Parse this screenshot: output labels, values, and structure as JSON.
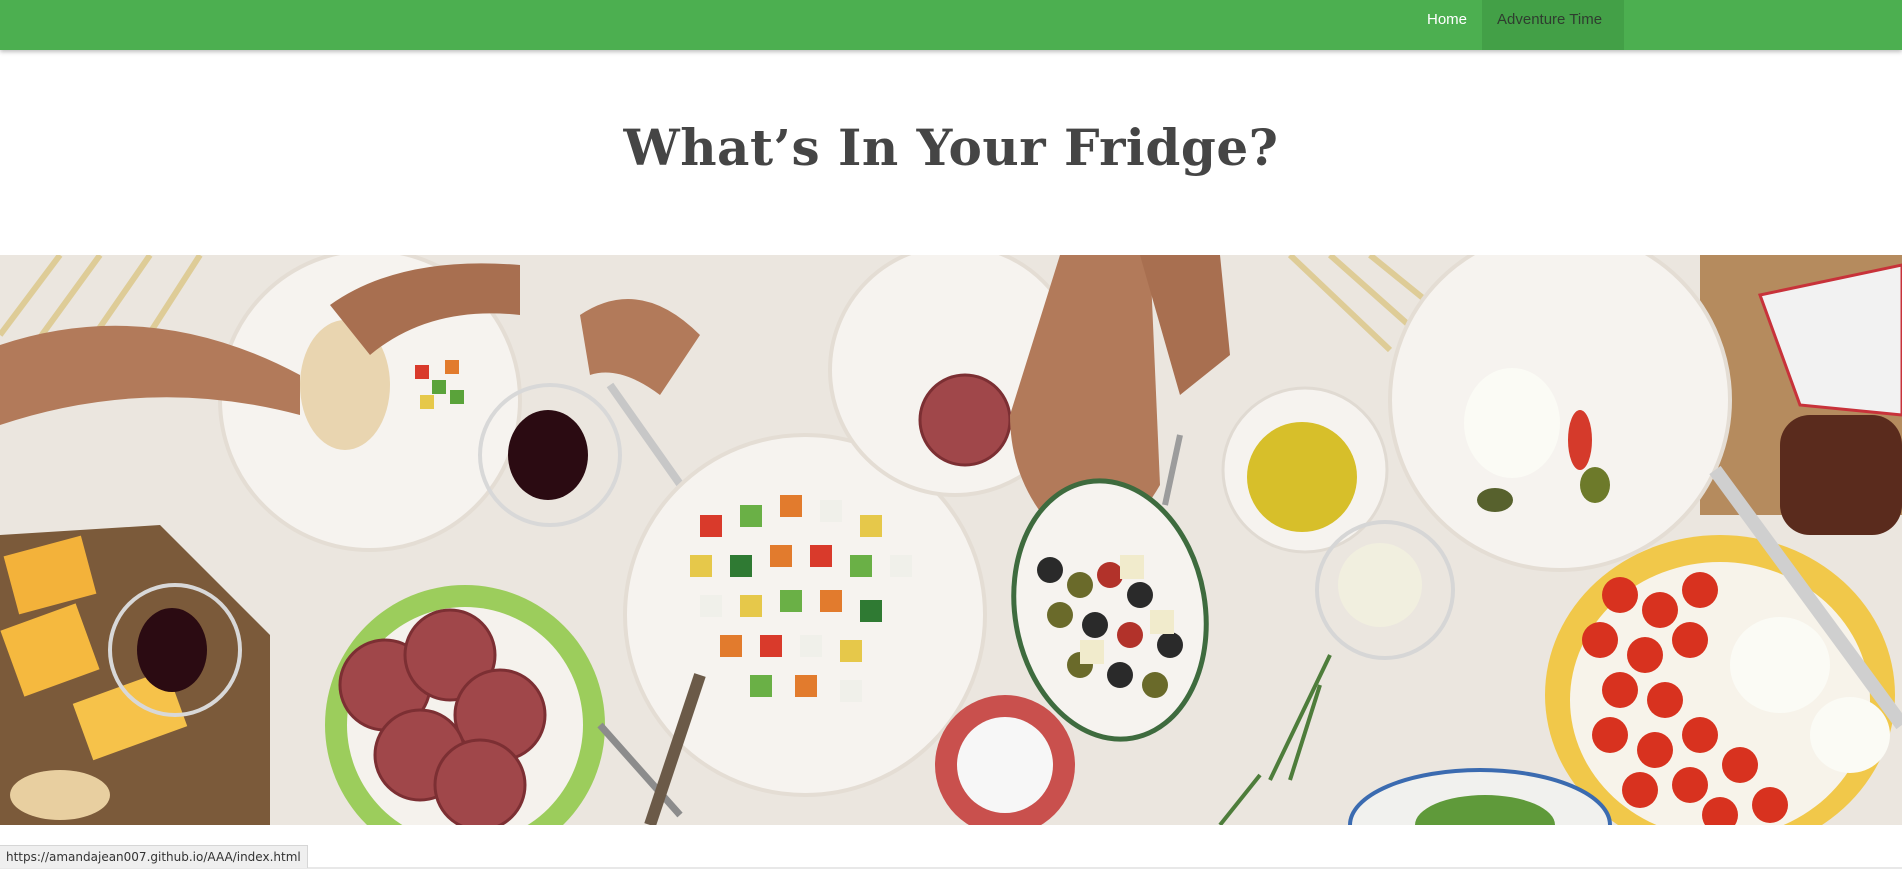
{
  "nav": {
    "items": [
      {
        "label": "Home",
        "active": false
      },
      {
        "label": "Adventure Time",
        "active": true
      }
    ]
  },
  "header": {
    "title": "What’s In Your Fridge?"
  },
  "hero": {
    "description_icon": "food-table-photo"
  },
  "status": {
    "url": "https://amandajean007.github.io/AAA/index.html"
  },
  "colors": {
    "navbar": "#4caf50",
    "nav_active": "#43a047",
    "title": "#454545"
  }
}
